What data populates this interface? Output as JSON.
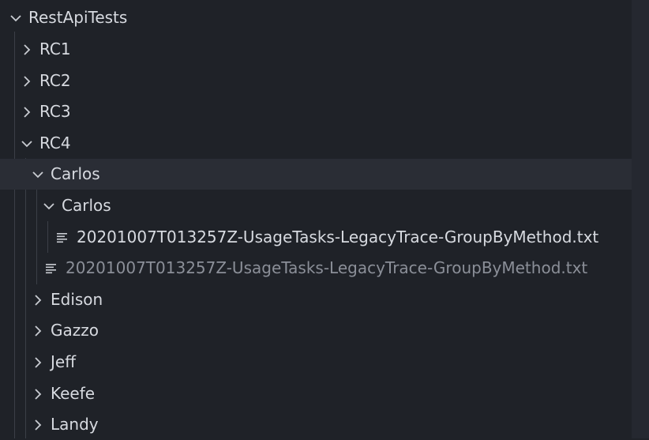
{
  "tree": {
    "root": {
      "label": "RestApiTests",
      "expanded": true
    },
    "rc1": {
      "label": "RC1",
      "expanded": false
    },
    "rc2": {
      "label": "RC2",
      "expanded": false
    },
    "rc3": {
      "label": "RC3",
      "expanded": false
    },
    "rc4": {
      "label": "RC4",
      "expanded": true
    },
    "carlos": {
      "label": "Carlos",
      "expanded": true,
      "selected": true
    },
    "carlos_inner": {
      "label": "Carlos",
      "expanded": true
    },
    "file_inner": {
      "label": "20201007T013257Z-UsageTasks-LegacyTrace-GroupByMethod.txt",
      "icon": "file-text-icon"
    },
    "file_outer": {
      "label": "20201007T013257Z-UsageTasks-LegacyTrace-GroupByMethod.txt",
      "icon": "file-text-icon",
      "dimmed": true
    },
    "edison": {
      "label": "Edison",
      "expanded": false
    },
    "gazzo": {
      "label": "Gazzo",
      "expanded": false
    },
    "jeff": {
      "label": "Jeff",
      "expanded": false
    },
    "keefe": {
      "label": "Keefe",
      "expanded": false
    },
    "landy": {
      "label": "Landy",
      "expanded": false
    }
  },
  "colors": {
    "background": "#1f2228",
    "selected_row": "#2a2d35",
    "text": "#d7dae0",
    "dimmed_text": "#8b8f98",
    "scrollbar_track": "#252830",
    "scrollbar_thumb": "#3a3d45"
  }
}
